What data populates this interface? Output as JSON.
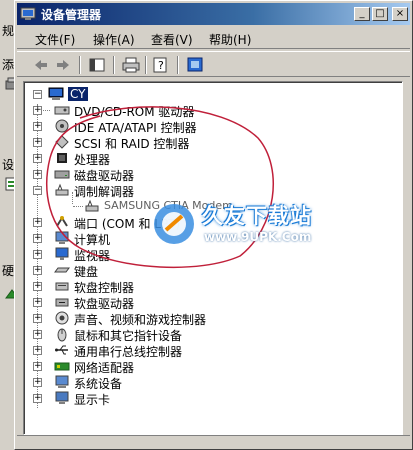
{
  "window": {
    "title": "设备管理器"
  },
  "background_dialog": {
    "labels": [
      "规",
      "添",
      "设",
      "硬"
    ]
  },
  "menu": {
    "items": [
      "文件(F)",
      "操作(A)",
      "查看(V)",
      "帮助(H)"
    ]
  },
  "tree": {
    "root": "CY",
    "items": [
      {
        "label": "DVD/CD-ROM 驱动器",
        "icon": "cdrom-icon",
        "expander": "+"
      },
      {
        "label": "IDE ATA/ATAPI 控制器",
        "icon": "ide-controller-icon",
        "expander": "+"
      },
      {
        "label": "SCSI 和 RAID 控制器",
        "icon": "scsi-icon",
        "expander": "+"
      },
      {
        "label": "处理器",
        "icon": "processor-icon",
        "expander": "+"
      },
      {
        "label": "磁盘驱动器",
        "icon": "disk-drive-icon",
        "expander": "+"
      },
      {
        "label": "调制解调器",
        "icon": "modem-icon",
        "expander": "−"
      },
      {
        "label": "SAMSUNG CTIA Modem",
        "icon": "modem-icon",
        "expander": ""
      },
      {
        "label": "端口 (COM 和 LPT)",
        "icon": "port-icon",
        "expander": "+"
      },
      {
        "label": "计算机",
        "icon": "computer-icon",
        "expander": "+"
      },
      {
        "label": "监视器",
        "icon": "monitor-icon",
        "expander": "+"
      },
      {
        "label": "键盘",
        "icon": "keyboard-icon",
        "expander": "+"
      },
      {
        "label": "软盘控制器",
        "icon": "floppy-controller-icon",
        "expander": "+"
      },
      {
        "label": "软盘驱动器",
        "icon": "floppy-drive-icon",
        "expander": "+"
      },
      {
        "label": "声音、视频和游戏控制器",
        "icon": "sound-icon",
        "expander": "+"
      },
      {
        "label": "鼠标和其它指针设备",
        "icon": "mouse-icon",
        "expander": "+"
      },
      {
        "label": "通用串行总线控制器",
        "icon": "usb-icon",
        "expander": "+"
      },
      {
        "label": "网络适配器",
        "icon": "network-adapter-icon",
        "expander": "+"
      },
      {
        "label": "系统设备",
        "icon": "system-device-icon",
        "expander": "+"
      },
      {
        "label": "显示卡",
        "icon": "display-adapter-icon",
        "expander": "+"
      }
    ]
  },
  "watermark": {
    "title": "久友下载站",
    "url": "www.9UPK.Com"
  },
  "colors": {
    "title_start": "#0a246a",
    "title_end": "#a6caf0",
    "face": "#d4d0c8",
    "annotation": "#c0203a"
  }
}
